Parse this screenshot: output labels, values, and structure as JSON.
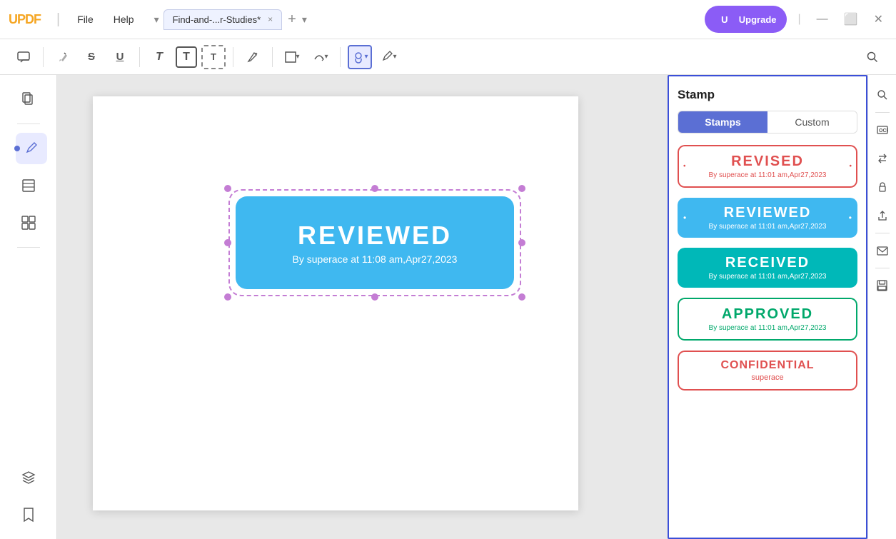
{
  "titlebar": {
    "logo": "UPDF",
    "menu": [
      {
        "label": "File"
      },
      {
        "label": "Help"
      }
    ],
    "tab_chevron": "▾",
    "tab_name": "Find-and-...r-Studies*",
    "tab_close": "×",
    "tab_add": "+",
    "tab_dropdown": "▾",
    "upgrade_label": "Upgrade",
    "avatar_label": "U",
    "window_minimize": "—",
    "window_maximize": "⬜",
    "window_close": "✕"
  },
  "toolbar": {
    "comment_icon": "💬",
    "highlight_icon": "✏",
    "strikethrough_icon": "S",
    "underline_icon": "U",
    "text_t_icon": "T",
    "text_T_icon": "T",
    "text_bracket_icon": "T",
    "ink_icon": "✒",
    "shape_icon": "⬜",
    "shape_arrow": "▾",
    "arc_icon": "↩",
    "arc_arrow": "▾",
    "stamp_icon": "👤",
    "stamp_arrow": "▾",
    "pen_icon": "✒",
    "pen_arrow": "▾",
    "search_icon": "🔍"
  },
  "sidebar": {
    "items": [
      {
        "id": "pages",
        "icon": "⊞"
      },
      {
        "id": "annotate",
        "icon": "✏",
        "active": true
      },
      {
        "id": "pages2",
        "icon": "📋"
      },
      {
        "id": "organize",
        "icon": "⊞"
      },
      {
        "id": "layers",
        "icon": "⧉"
      },
      {
        "id": "bookmark",
        "icon": "🔖"
      }
    ]
  },
  "right_sidebar": {
    "items": [
      {
        "id": "search",
        "icon": "🔍"
      },
      {
        "id": "ocr",
        "icon": "⊞"
      },
      {
        "id": "convert",
        "icon": "🔄"
      },
      {
        "id": "protect",
        "icon": "🔒"
      },
      {
        "id": "share",
        "icon": "↑"
      },
      {
        "id": "email",
        "icon": "✉"
      },
      {
        "id": "save",
        "icon": "💾"
      }
    ]
  },
  "stamp_panel": {
    "title": "Stamp",
    "tabs": [
      {
        "label": "Stamps",
        "active": true
      },
      {
        "label": "Custom",
        "active": false
      }
    ],
    "stamps": [
      {
        "id": "revised",
        "main_text": "REVISED",
        "sub_text": "By superace at 11:01 am,Apr27,2023",
        "type": "revised"
      },
      {
        "id": "reviewed",
        "main_text": "REVIEWED",
        "sub_text": "By superace at 11:01 am,Apr27,2023",
        "type": "reviewed"
      },
      {
        "id": "received",
        "main_text": "RECEIVED",
        "sub_text": "By superace at 11:01 am,Apr27,2023",
        "type": "received"
      },
      {
        "id": "approved",
        "main_text": "APPROVED",
        "sub_text": "By superace at 11:01 am,Apr27,2023",
        "type": "approved"
      },
      {
        "id": "confidential",
        "main_text": "CONFIDENTIAL",
        "sub_text": "superace",
        "type": "confidential"
      }
    ]
  },
  "page_stamp": {
    "main_text": "REVIEWED",
    "sub_text": "By superace at 11:08 am,Apr27,2023"
  }
}
